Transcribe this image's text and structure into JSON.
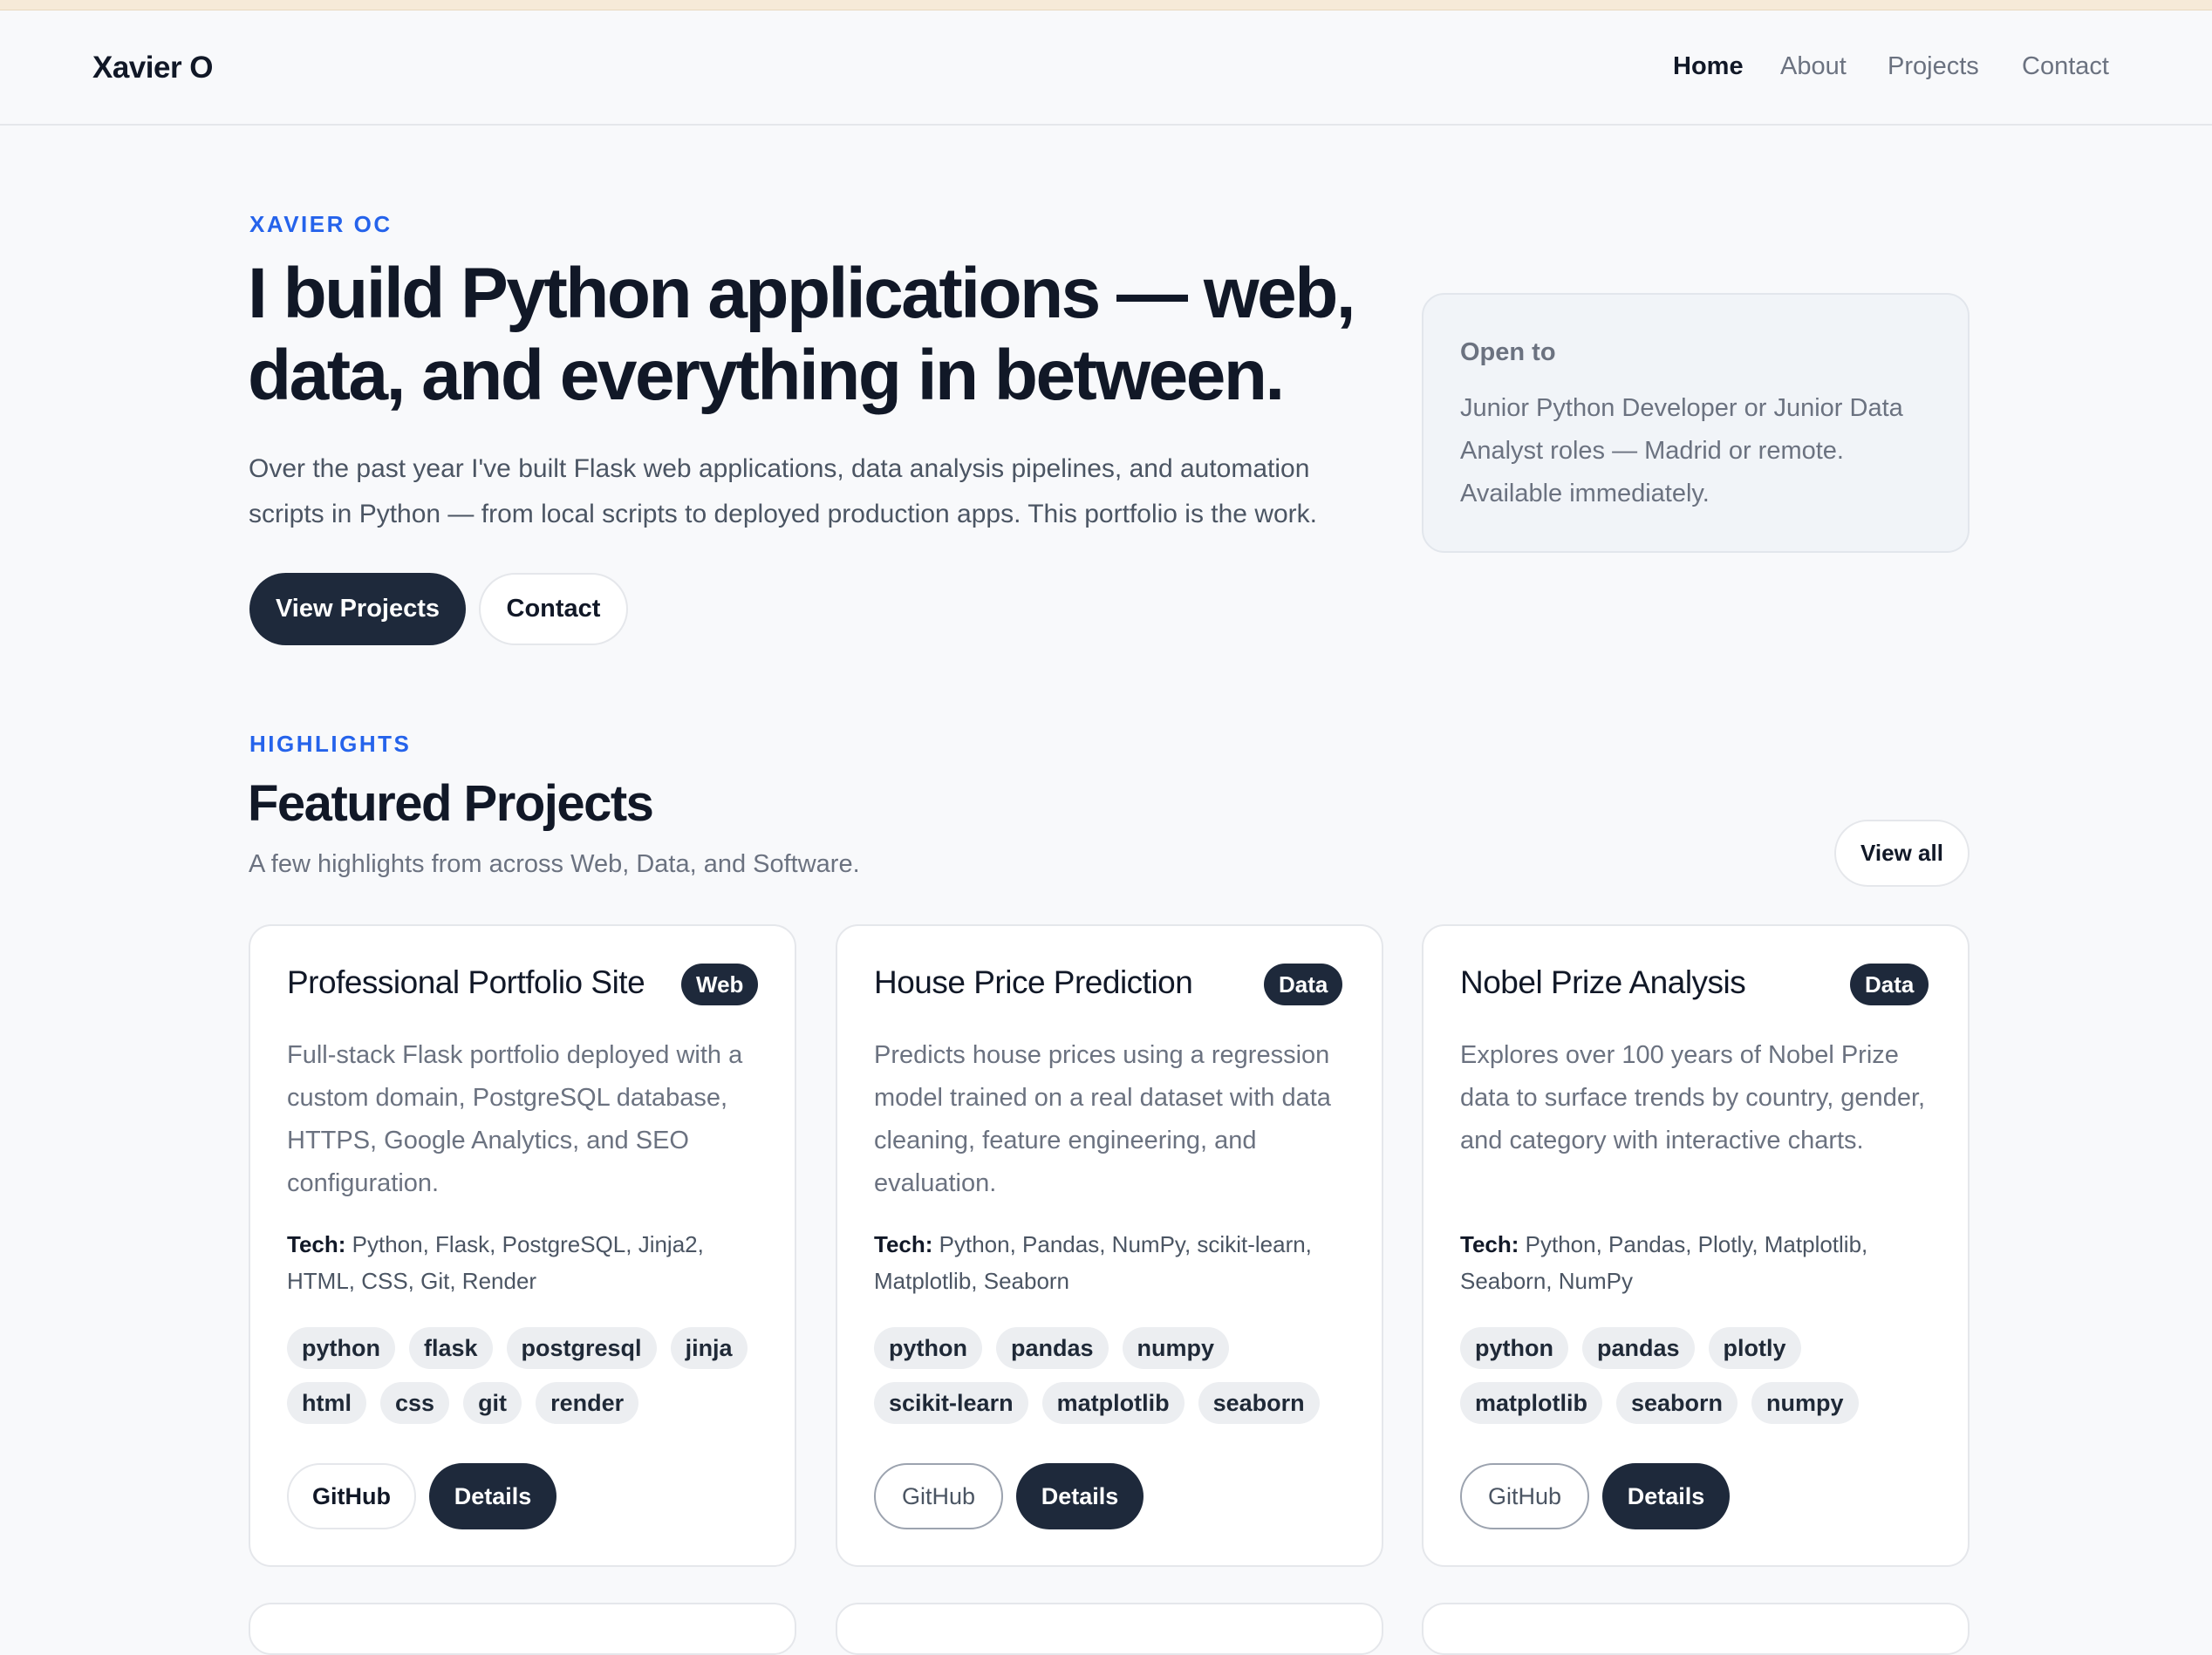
{
  "nav": {
    "brand": "Xavier O",
    "links": [
      "Home",
      "About",
      "Projects",
      "Contact"
    ],
    "active": "Home"
  },
  "hero": {
    "eyebrow": "XAVIER OC",
    "title_line1": "I build Python applications — web,",
    "title_line2": "data, and everything in between.",
    "text": "Over the past year I've built Flask web applications, data analysis pipelines, and automation scripts in Python — from local scripts to deployed production apps. This portfolio is the work.",
    "primary_button": "View Projects",
    "secondary_button": "Contact"
  },
  "open_to": {
    "title": "Open to",
    "text": "Junior Python Developer or Junior Data Analyst roles — Madrid or remote. Available immediately."
  },
  "highlights": {
    "eyebrow": "HIGHLIGHTS",
    "title": "Featured Projects",
    "subtitle": "A few highlights from across Web, Data, and Software.",
    "view_all": "View all"
  },
  "projects": [
    {
      "title": "Professional Portfolio Site",
      "badge": "Web",
      "description": "Full-stack Flask portfolio deployed with a custom domain, PostgreSQL database, HTTPS, Google Analytics, and SEO configuration.",
      "tech_label": "Tech:",
      "tech": "Python, Flask, PostgreSQL, Jinja2, HTML, CSS, Git, Render",
      "tags": [
        "python",
        "flask",
        "postgresql",
        "jinja",
        "html",
        "css",
        "git",
        "render"
      ],
      "github": "GitHub",
      "details": "Details"
    },
    {
      "title": "House Price Prediction",
      "badge": "Data",
      "description": "Predicts house prices using a regression model trained on a real dataset with data cleaning, feature engineering, and evaluation.",
      "tech_label": "Tech:",
      "tech": "Python, Pandas, NumPy, scikit-learn, Matplotlib, Seaborn",
      "tags": [
        "python",
        "pandas",
        "numpy",
        "scikit-learn",
        "matplotlib",
        "seaborn"
      ],
      "github": "GitHub",
      "details": "Details"
    },
    {
      "title": "Nobel Prize Analysis",
      "badge": "Data",
      "description": "Explores over 100 years of Nobel Prize data to surface trends by country, gender, and category with interactive charts.",
      "tech_label": "Tech:",
      "tech": "Python, Pandas, Plotly, Matplotlib, Seaborn, NumPy",
      "tags": [
        "python",
        "pandas",
        "plotly",
        "matplotlib",
        "seaborn",
        "numpy"
      ],
      "github": "GitHub",
      "details": "Details"
    }
  ]
}
